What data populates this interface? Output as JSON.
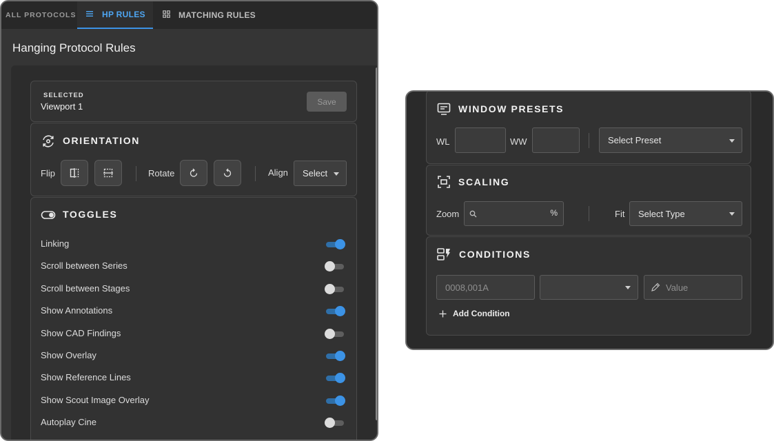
{
  "tabs": {
    "all": "ALL PROTOCOLS",
    "hp": "HP RULES",
    "matching": "MATCHING RULES"
  },
  "page_title": "Hanging Protocol Rules",
  "selected": {
    "label": "SELECTED",
    "value": "Viewport 1",
    "save_label": "Save"
  },
  "orientation": {
    "title": "ORIENTATION",
    "flip_label": "Flip",
    "rotate_label": "Rotate",
    "align_label": "Align",
    "align_value": "Select"
  },
  "toggles": {
    "title": "TOGGLES",
    "items": [
      {
        "label": "Linking",
        "on": true
      },
      {
        "label": "Scroll between Series",
        "on": false
      },
      {
        "label": "Scroll between Stages",
        "on": false
      },
      {
        "label": "Show Annotations",
        "on": true
      },
      {
        "label": "Show CAD Findings",
        "on": false
      },
      {
        "label": "Show Overlay",
        "on": true
      },
      {
        "label": "Show Reference Lines",
        "on": true
      },
      {
        "label": "Show Scout Image Overlay",
        "on": true
      },
      {
        "label": "Autoplay Cine",
        "on": false
      }
    ]
  },
  "window_presets": {
    "title": "WINDOW PRESETS",
    "wl_label": "WL",
    "ww_label": "WW",
    "wl_value": "",
    "ww_value": "",
    "preset_value": "Select Preset"
  },
  "scaling": {
    "title": "SCALING",
    "zoom_label": "Zoom",
    "zoom_unit": "%",
    "zoom_value": "",
    "fit_label": "Fit",
    "fit_value": "Select Type"
  },
  "conditions": {
    "title": "CONDITIONS",
    "tag_placeholder": "0008,001A",
    "operator_value": "",
    "value_placeholder": "Value",
    "add_label": "Add Condition"
  },
  "colors": {
    "accent": "#3c93e6",
    "panel": "#323232",
    "background": "#2a2a2a"
  }
}
